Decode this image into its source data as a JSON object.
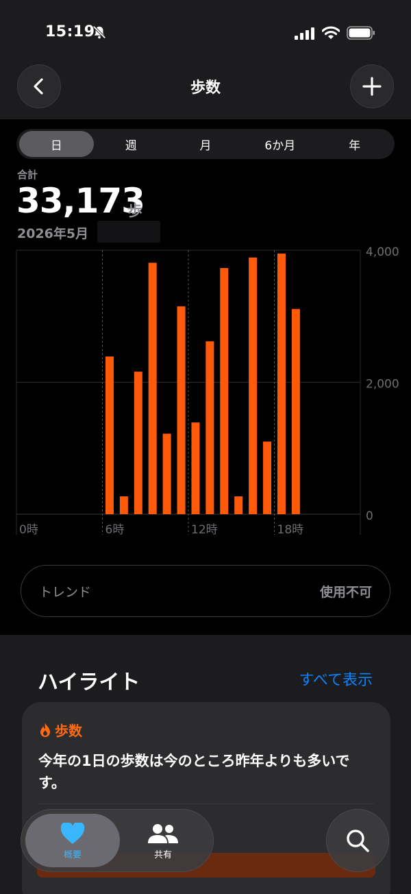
{
  "status_bar": {
    "time": "15:19"
  },
  "nav": {
    "title": "歩数"
  },
  "segments": [
    "日",
    "週",
    "月",
    "6か月",
    "年"
  ],
  "summary": {
    "label": "合計",
    "value": "33,173",
    "unit": "歩",
    "date": "2026年5月"
  },
  "chart_data": {
    "type": "bar",
    "x_tick_labels": [
      "0時",
      "6時",
      "12時",
      "18時"
    ],
    "y_tick_labels": [
      "4,000",
      "2,000",
      "0"
    ],
    "ylim": [
      0,
      4000
    ],
    "grid": true,
    "bar_color": "#ff5a0a",
    "categories": [
      6,
      7,
      8,
      9,
      10,
      11,
      12,
      13,
      14,
      15,
      16,
      17,
      18,
      19
    ],
    "values": [
      2390,
      270,
      2160,
      3810,
      1220,
      3150,
      1390,
      2620,
      3730,
      270,
      3890,
      1100,
      3950,
      3110
    ]
  },
  "trend": {
    "label": "トレンド",
    "value": "使用不可"
  },
  "highlights": {
    "title": "ハイライト",
    "show_all": "すべて表示",
    "card": {
      "category": "歩数",
      "text": "今年の1日の歩数は今のところ昨年よりも多いです。"
    }
  },
  "tabbar": {
    "tabs": [
      {
        "label": "概要"
      },
      {
        "label": "共有"
      }
    ]
  },
  "colors": {
    "accent_orange": "#ff5a0a",
    "link_blue": "#0a84ff",
    "heart_blue": "#38b6ff"
  }
}
